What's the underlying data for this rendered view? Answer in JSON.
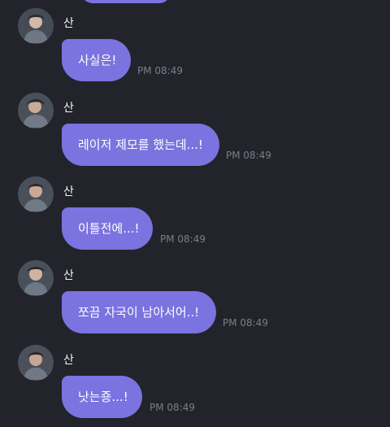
{
  "chat": {
    "messages": [
      {
        "sender": "산",
        "text": "사실은!",
        "time": "PM 08:49"
      },
      {
        "sender": "산",
        "text": "레이저 제모를 했는데...!",
        "time": "PM 08:49"
      },
      {
        "sender": "산",
        "text": "이틀전에...!",
        "time": "PM 08:49"
      },
      {
        "sender": "산",
        "text": "쪼끔 자국이 남아서어..!",
        "time": "PM 08:49"
      },
      {
        "sender": "산",
        "text": "낫는죵...!",
        "time": "PM 08:49"
      }
    ]
  },
  "theme": {
    "background": "#23242b",
    "bubble": "#7b73df",
    "text": "#ffffff",
    "time": "#7c7d86"
  }
}
